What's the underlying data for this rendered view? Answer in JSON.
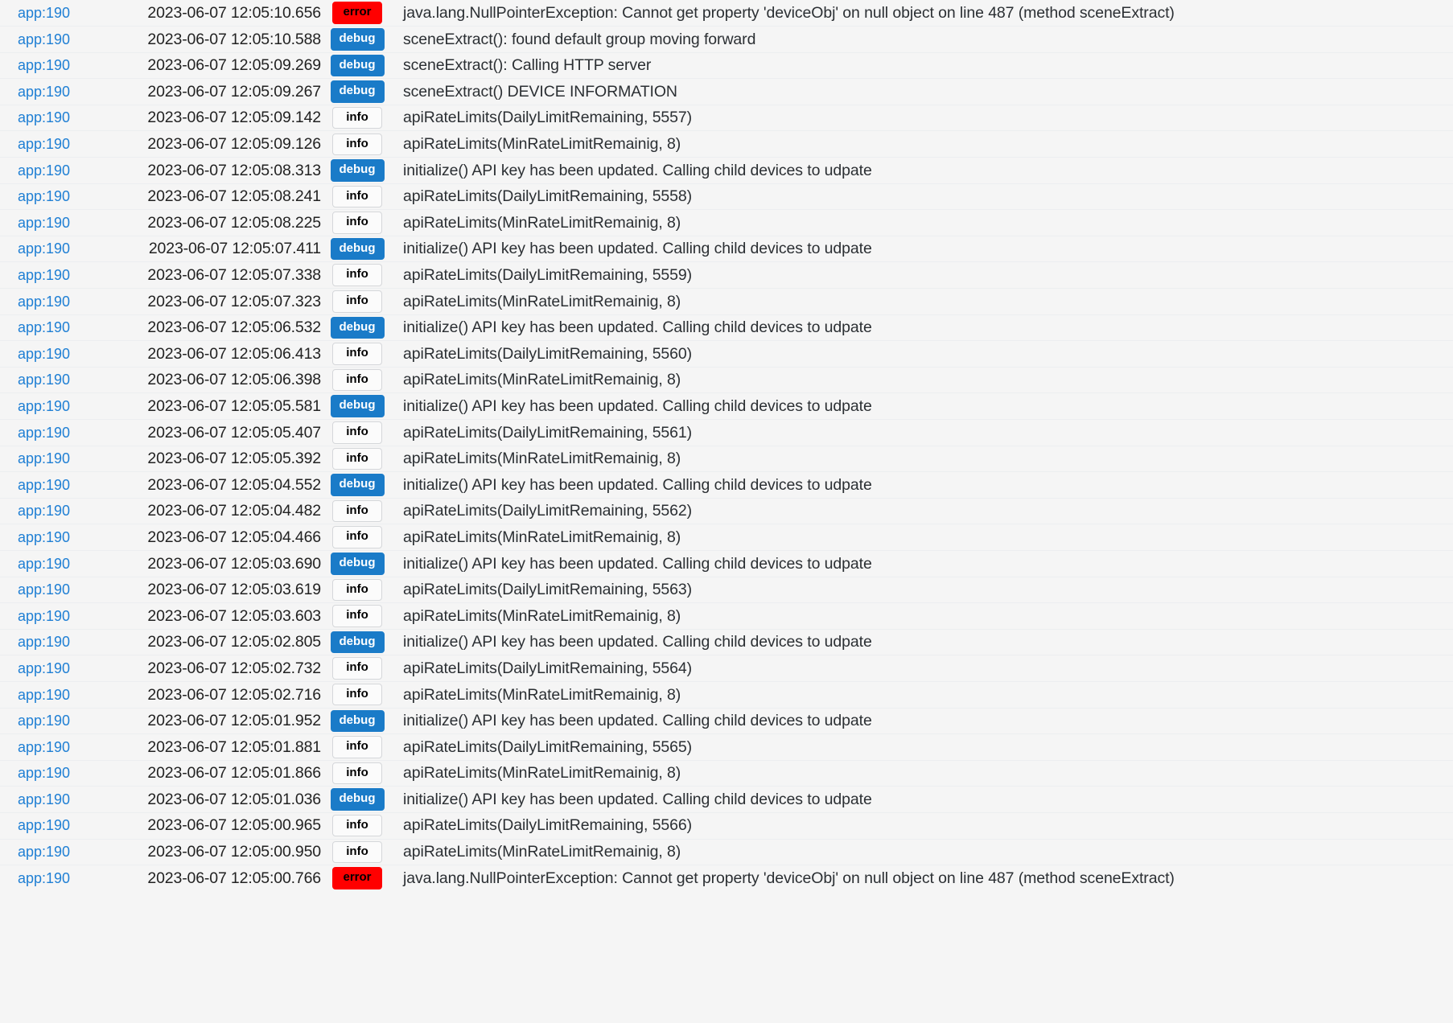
{
  "view": {
    "name": "log-viewer",
    "background_color": "#f5f5f5",
    "link_color": "#1f7fd4",
    "text_color": "#2b2f33",
    "row_divider_color": "#eceef0"
  },
  "levels": {
    "error": {
      "label": "error",
      "background": "#ff0000",
      "text_color": "#000000"
    },
    "debug": {
      "label": "debug",
      "background": "#1a7bc8",
      "text_color": "#ffffff"
    },
    "info": {
      "label": "info",
      "background": "#fbfbfb",
      "text_color": "#000000"
    }
  },
  "log": {
    "rows": [
      {
        "source": "app:190",
        "time": "2023-06-07 12:05:10.656",
        "level": "error",
        "level_label": "error",
        "message": "java.lang.NullPointerException: Cannot get property 'deviceObj' on null object on line 487 (method sceneExtract)"
      },
      {
        "source": "app:190",
        "time": "2023-06-07 12:05:10.588",
        "level": "debug",
        "level_label": "debug",
        "message": "sceneExtract(): found default group moving forward"
      },
      {
        "source": "app:190",
        "time": "2023-06-07 12:05:09.269",
        "level": "debug",
        "level_label": "debug",
        "message": "sceneExtract(): Calling HTTP server"
      },
      {
        "source": "app:190",
        "time": "2023-06-07 12:05:09.267",
        "level": "debug",
        "level_label": "debug",
        "message": "sceneExtract() DEVICE INFORMATION"
      },
      {
        "source": "app:190",
        "time": "2023-06-07 12:05:09.142",
        "level": "info",
        "level_label": "info",
        "message": "apiRateLimits(DailyLimitRemaining, 5557)"
      },
      {
        "source": "app:190",
        "time": "2023-06-07 12:05:09.126",
        "level": "info",
        "level_label": "info",
        "message": "apiRateLimits(MinRateLimitRemainig, 8)"
      },
      {
        "source": "app:190",
        "time": "2023-06-07 12:05:08.313",
        "level": "debug",
        "level_label": "debug",
        "message": "initialize() API key has been updated. Calling child devices to udpate"
      },
      {
        "source": "app:190",
        "time": "2023-06-07 12:05:08.241",
        "level": "info",
        "level_label": "info",
        "message": "apiRateLimits(DailyLimitRemaining, 5558)"
      },
      {
        "source": "app:190",
        "time": "2023-06-07 12:05:08.225",
        "level": "info",
        "level_label": "info",
        "message": "apiRateLimits(MinRateLimitRemainig, 8)"
      },
      {
        "source": "app:190",
        "time": "2023-06-07 12:05:07.411",
        "level": "debug",
        "level_label": "debug",
        "message": "initialize() API key has been updated. Calling child devices to udpate"
      },
      {
        "source": "app:190",
        "time": "2023-06-07 12:05:07.338",
        "level": "info",
        "level_label": "info",
        "message": "apiRateLimits(DailyLimitRemaining, 5559)"
      },
      {
        "source": "app:190",
        "time": "2023-06-07 12:05:07.323",
        "level": "info",
        "level_label": "info",
        "message": "apiRateLimits(MinRateLimitRemainig, 8)"
      },
      {
        "source": "app:190",
        "time": "2023-06-07 12:05:06.532",
        "level": "debug",
        "level_label": "debug",
        "message": "initialize() API key has been updated. Calling child devices to udpate"
      },
      {
        "source": "app:190",
        "time": "2023-06-07 12:05:06.413",
        "level": "info",
        "level_label": "info",
        "message": "apiRateLimits(DailyLimitRemaining, 5560)"
      },
      {
        "source": "app:190",
        "time": "2023-06-07 12:05:06.398",
        "level": "info",
        "level_label": "info",
        "message": "apiRateLimits(MinRateLimitRemainig, 8)"
      },
      {
        "source": "app:190",
        "time": "2023-06-07 12:05:05.581",
        "level": "debug",
        "level_label": "debug",
        "message": "initialize() API key has been updated. Calling child devices to udpate"
      },
      {
        "source": "app:190",
        "time": "2023-06-07 12:05:05.407",
        "level": "info",
        "level_label": "info",
        "message": "apiRateLimits(DailyLimitRemaining, 5561)"
      },
      {
        "source": "app:190",
        "time": "2023-06-07 12:05:05.392",
        "level": "info",
        "level_label": "info",
        "message": "apiRateLimits(MinRateLimitRemainig, 8)"
      },
      {
        "source": "app:190",
        "time": "2023-06-07 12:05:04.552",
        "level": "debug",
        "level_label": "debug",
        "message": "initialize() API key has been updated. Calling child devices to udpate"
      },
      {
        "source": "app:190",
        "time": "2023-06-07 12:05:04.482",
        "level": "info",
        "level_label": "info",
        "message": "apiRateLimits(DailyLimitRemaining, 5562)"
      },
      {
        "source": "app:190",
        "time": "2023-06-07 12:05:04.466",
        "level": "info",
        "level_label": "info",
        "message": "apiRateLimits(MinRateLimitRemainig, 8)"
      },
      {
        "source": "app:190",
        "time": "2023-06-07 12:05:03.690",
        "level": "debug",
        "level_label": "debug",
        "message": "initialize() API key has been updated. Calling child devices to udpate"
      },
      {
        "source": "app:190",
        "time": "2023-06-07 12:05:03.619",
        "level": "info",
        "level_label": "info",
        "message": "apiRateLimits(DailyLimitRemaining, 5563)"
      },
      {
        "source": "app:190",
        "time": "2023-06-07 12:05:03.603",
        "level": "info",
        "level_label": "info",
        "message": "apiRateLimits(MinRateLimitRemainig, 8)"
      },
      {
        "source": "app:190",
        "time": "2023-06-07 12:05:02.805",
        "level": "debug",
        "level_label": "debug",
        "message": "initialize() API key has been updated. Calling child devices to udpate"
      },
      {
        "source": "app:190",
        "time": "2023-06-07 12:05:02.732",
        "level": "info",
        "level_label": "info",
        "message": "apiRateLimits(DailyLimitRemaining, 5564)"
      },
      {
        "source": "app:190",
        "time": "2023-06-07 12:05:02.716",
        "level": "info",
        "level_label": "info",
        "message": "apiRateLimits(MinRateLimitRemainig, 8)"
      },
      {
        "source": "app:190",
        "time": "2023-06-07 12:05:01.952",
        "level": "debug",
        "level_label": "debug",
        "message": "initialize() API key has been updated. Calling child devices to udpate"
      },
      {
        "source": "app:190",
        "time": "2023-06-07 12:05:01.881",
        "level": "info",
        "level_label": "info",
        "message": "apiRateLimits(DailyLimitRemaining, 5565)"
      },
      {
        "source": "app:190",
        "time": "2023-06-07 12:05:01.866",
        "level": "info",
        "level_label": "info",
        "message": "apiRateLimits(MinRateLimitRemainig, 8)"
      },
      {
        "source": "app:190",
        "time": "2023-06-07 12:05:01.036",
        "level": "debug",
        "level_label": "debug",
        "message": "initialize() API key has been updated. Calling child devices to udpate"
      },
      {
        "source": "app:190",
        "time": "2023-06-07 12:05:00.965",
        "level": "info",
        "level_label": "info",
        "message": "apiRateLimits(DailyLimitRemaining, 5566)"
      },
      {
        "source": "app:190",
        "time": "2023-06-07 12:05:00.950",
        "level": "info",
        "level_label": "info",
        "message": "apiRateLimits(MinRateLimitRemainig, 8)"
      },
      {
        "source": "app:190",
        "time": "2023-06-07 12:05:00.766",
        "level": "error",
        "level_label": "error",
        "message": "java.lang.NullPointerException: Cannot get property 'deviceObj' on null object on line 487 (method sceneExtract)"
      }
    ]
  }
}
